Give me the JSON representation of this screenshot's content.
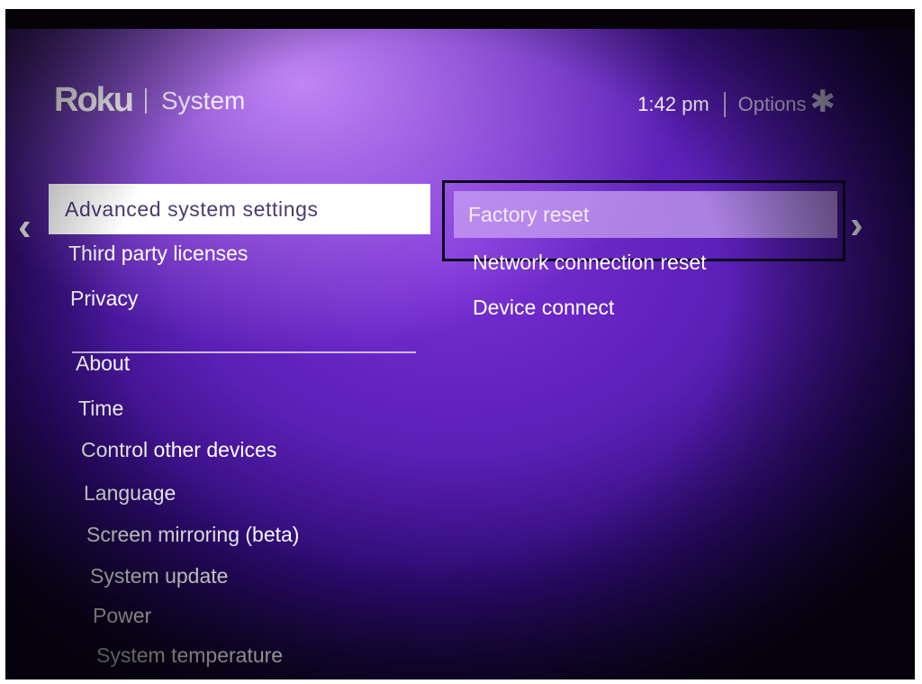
{
  "header": {
    "brand": "Roku",
    "section": "System",
    "clock": "1:42 pm",
    "options_label": "Options",
    "options_icon": "✱"
  },
  "nav": {
    "left_chevron": "‹",
    "right_chevron": "›"
  },
  "left_menu": {
    "selected_index": 0,
    "items": [
      "Advanced system settings",
      "Third party licenses",
      "Privacy",
      "About",
      "Time",
      "Control other devices",
      "Language",
      "Screen mirroring (beta)",
      "System update",
      "Power",
      "System temperature"
    ]
  },
  "right_menu": {
    "selected_index": 0,
    "items": [
      "Factory reset",
      "Network connection reset",
      "Device connect"
    ]
  },
  "colors": {
    "background_primary": "#5a1fb5",
    "background_highlight": "#d296ff",
    "selected_left_bg": "#ffffff",
    "selected_left_text": "#4b3b6e",
    "focus_border": "#0b0520"
  },
  "icons": {
    "options": "asterisk-icon",
    "left_chevron": "chevron-left-icon",
    "right_chevron": "chevron-right-icon"
  }
}
